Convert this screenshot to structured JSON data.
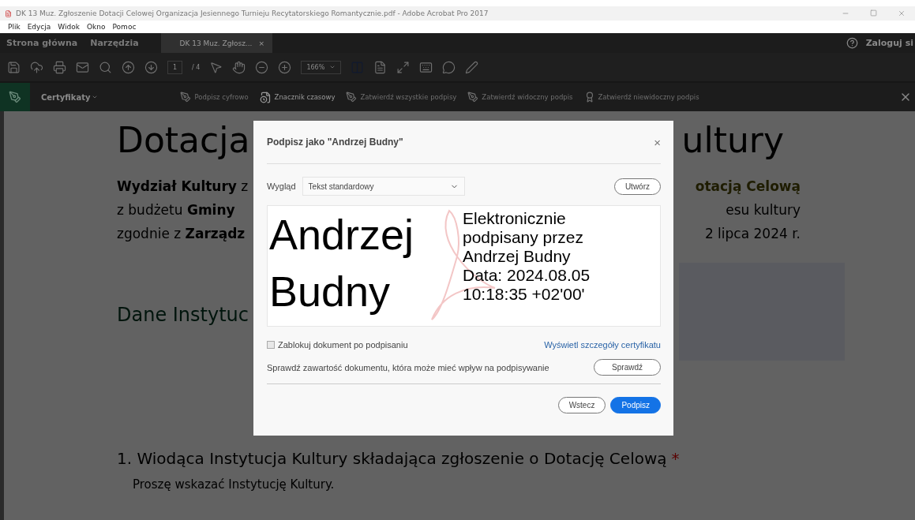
{
  "window": {
    "title": "DK 13 Muz. Zgłoszenie Dotacji Celowej Organizacja Jesiennego Turnieju Recytatorskiego Romantycznie.pdf - Adobe Acrobat Pro 2017"
  },
  "menu": [
    "Plik",
    "Edycja",
    "Widok",
    "Okno",
    "Pomoc"
  ],
  "tabs": [
    {
      "label": "Strona główna",
      "kind": "nav",
      "selected": false
    },
    {
      "label": "Narzędzia",
      "kind": "nav",
      "selected": false
    },
    {
      "label": "DK 13 Muz. Zgłosz...",
      "kind": "document",
      "selected": true
    }
  ],
  "tab_close": "×",
  "account": {
    "label": "Zaloguj si"
  },
  "toolbar": {
    "page_current": "1",
    "page_total": "/ 4",
    "zoom": "166%"
  },
  "cert_toolbar": {
    "title": "Certyfikaty",
    "tools": [
      {
        "label": "Podpisz cyfrowo",
        "disabled": true
      },
      {
        "label": "Znacznik czasowy",
        "disabled": false
      },
      {
        "label": "Zatwierdź wszystkie podpisy",
        "disabled": true
      },
      {
        "label": "Zatwierdź widoczny podpis",
        "disabled": true
      },
      {
        "label": "Zatwierdź niewidoczny podpis",
        "disabled": true
      }
    ]
  },
  "document": {
    "heading_left": "Dotacja",
    "heading_right": "ultury",
    "lines": [
      {
        "left": "**Wydział Kultury** z",
        "right": "otacją Celową",
        "right_accent": true
      },
      {
        "left": "z budżetu **Gminy**",
        "right": "esu kultury",
        "right_accent": false
      },
      {
        "left": "zgodnie z **Zarządz**",
        "right": "2 lipca 2024 r.",
        "right_accent": false
      }
    ],
    "section": "Dane Instytuc",
    "question": {
      "number": "1.",
      "text": "Wiodąca Instytucja Kultury składająca zgłoszenie o Dotację Celową",
      "required": "*",
      "hint": "Proszę wskazać Instytucję Kultury."
    }
  },
  "dialog": {
    "title": "Podpisz jako \"Andrzej Budny\"",
    "close": "×",
    "appearance_label": "Wygląd",
    "appearance_value": "Tekst standardowy",
    "create_button": "Utwórz",
    "preview": {
      "name_lines": [
        "Andrzej",
        "Budny"
      ],
      "detail_lines": [
        "Elektronicznie",
        "podpisany przez",
        "Andrzej Budny",
        "Data: 2024.08.05",
        "10:18:35 +02'00'"
      ]
    },
    "lock": {
      "label": "Zablokuj dokument po podpisaniu",
      "checked": false
    },
    "cert_link": "Wyświetl szczegóły certyfikatu",
    "check_text": "Sprawdź zawartość dokumentu, która może mieć wpływ na podpisywanie",
    "check_button": "Sprawdź",
    "buttons": [
      {
        "label": "Wstecz",
        "kind": "secondary"
      },
      {
        "label": "Podpisz",
        "kind": "primary"
      }
    ]
  }
}
